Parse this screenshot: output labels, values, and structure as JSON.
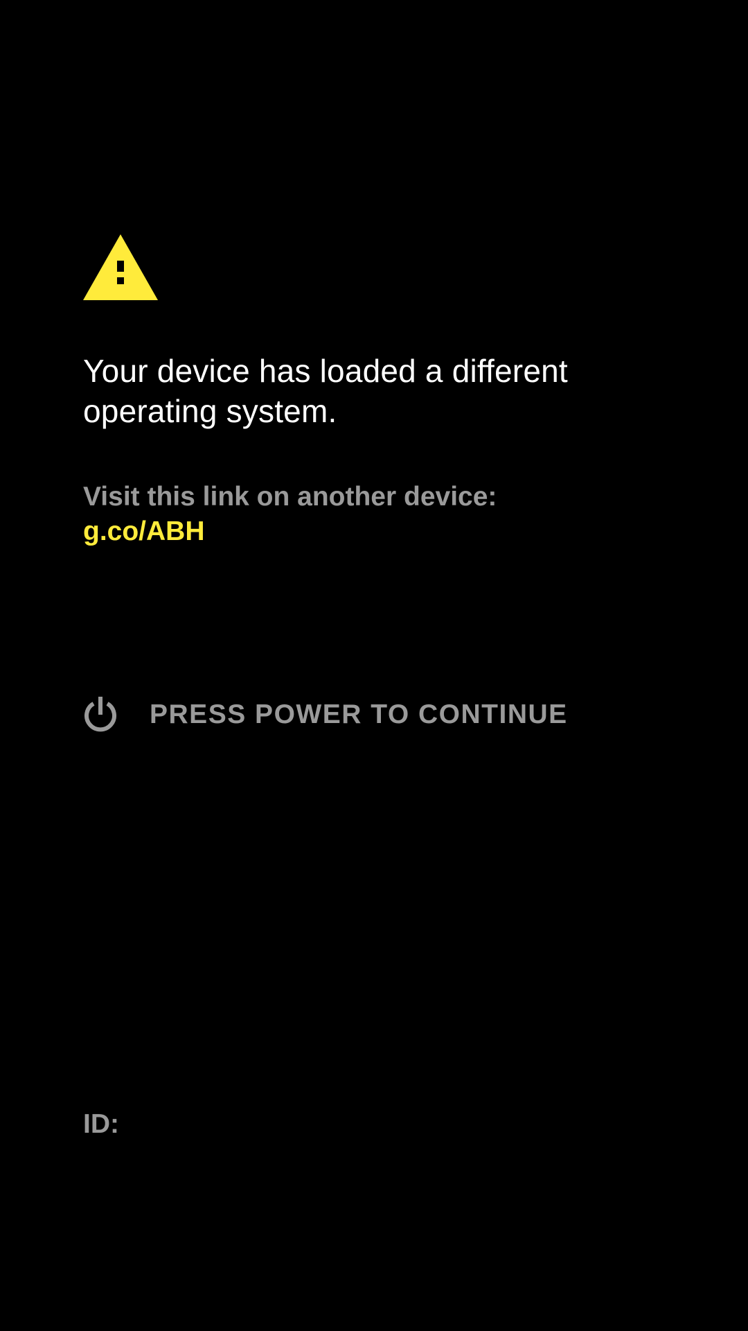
{
  "colors": {
    "background": "#000000",
    "warning": "#ffeb3b",
    "headline": "#ffffff",
    "secondary": "#9a9a9a",
    "link": "#ffeb3b"
  },
  "warning": {
    "icon": "warning-triangle-icon"
  },
  "message": {
    "headline": "Your device has loaded a different operating system.",
    "visit_label": "Visit this link on another device:",
    "link": "g.co/ABH"
  },
  "action": {
    "icon": "power-icon",
    "label": "PRESS POWER TO CONTINUE"
  },
  "footer": {
    "id_label": "ID:"
  }
}
